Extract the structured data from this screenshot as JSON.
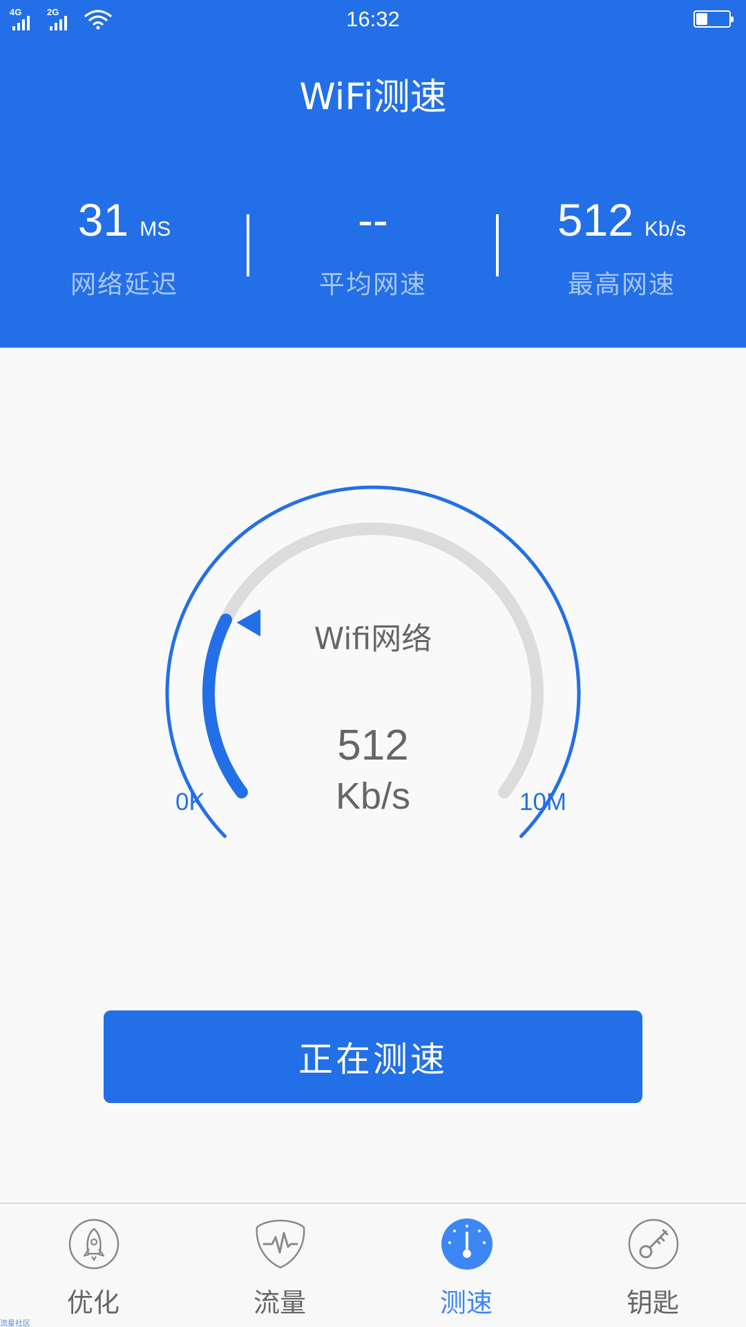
{
  "status_bar": {
    "sim1_label": "4G",
    "sim2_label": "2G",
    "time": "16:32",
    "battery_level": 0.35,
    "wifi_icon": "wifi-icon"
  },
  "header": {
    "title": "WiFi测速",
    "background_color": "#236fe7"
  },
  "stats": {
    "latency": {
      "value": "31",
      "unit": "MS",
      "label": "网络延迟"
    },
    "average": {
      "value": "--",
      "label": "平均网速"
    },
    "peak": {
      "value": "512",
      "unit": "Kb/s",
      "label": "最高网速"
    }
  },
  "gauge": {
    "caption": "Wifi网络",
    "value": "512",
    "unit": "Kb/s",
    "min_label": "0K",
    "max_label": "10M",
    "progress": 0.25,
    "accent_color": "#236fe7",
    "track_color": "#dcdcdc"
  },
  "action_button": {
    "label": "正在测速"
  },
  "nav": {
    "items": [
      {
        "label": "优化",
        "icon": "rocket-icon",
        "active": false
      },
      {
        "label": "流量",
        "icon": "pulse-shield-icon",
        "active": false
      },
      {
        "label": "测速",
        "icon": "speedometer-icon",
        "active": true
      },
      {
        "label": "钥匙",
        "icon": "key-icon",
        "active": false
      }
    ],
    "active_color": "#3d87f5"
  },
  "watermark": "流星社区"
}
